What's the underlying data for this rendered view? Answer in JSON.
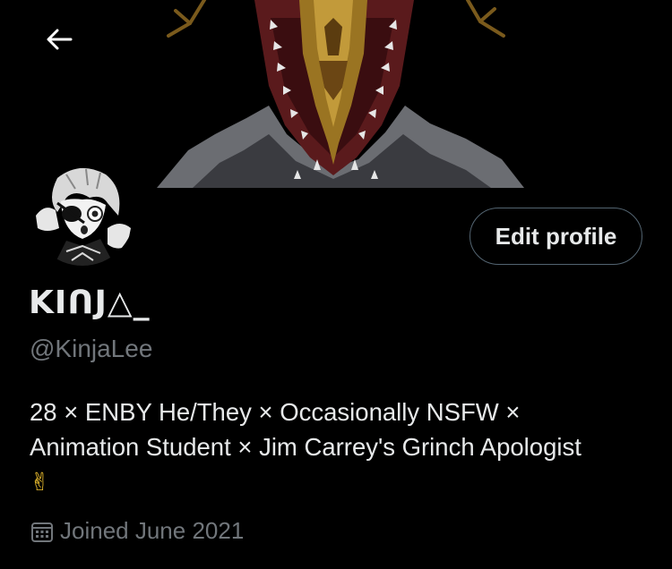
{
  "header": {
    "back_icon": "arrow-left-icon"
  },
  "profile": {
    "display_name": "KIᑎJ△_",
    "handle": "@KinjaLee",
    "bio_line1": "28 × ENBY He/They × Occasionally NSFW ×",
    "bio_line2": "Animation Student × Jim Carrey's Grinch Apologist",
    "bio_emoji": "✌",
    "joined_text": "Joined June 2021",
    "edit_label": "Edit profile"
  },
  "colors": {
    "background": "#000000",
    "primary_text": "#e7e9ea",
    "secondary_text": "#71767b",
    "button_border": "#536471"
  }
}
